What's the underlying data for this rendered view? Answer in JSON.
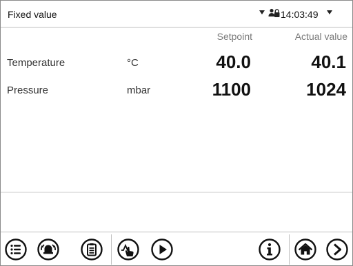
{
  "header": {
    "mode_title": "Fixed value",
    "time": "14:03:49"
  },
  "table": {
    "col_setpoint": "Setpoint",
    "col_actual": "Actual value",
    "rows": [
      {
        "label": "Temperature",
        "unit": "°C",
        "setpoint": "40.0",
        "actual": "40.1"
      },
      {
        "label": "Pressure",
        "unit": "mbar",
        "setpoint": "1100",
        "actual": "1024"
      }
    ]
  },
  "toolbar": {
    "icons": [
      "menu-icon",
      "alarm-icon",
      "event-list-icon",
      "manual-control-icon",
      "play-icon",
      "info-icon",
      "home-icon",
      "next-icon"
    ]
  },
  "colors": {
    "border": "#8a8a8a",
    "separator": "#bdbdbd",
    "header_gray": "#7a7a7a"
  }
}
